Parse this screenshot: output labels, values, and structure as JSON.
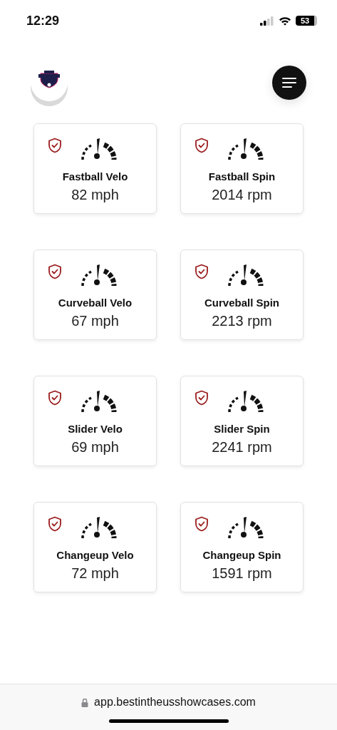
{
  "status_bar": {
    "time": "12:29",
    "battery": "53"
  },
  "metrics": [
    {
      "title": "Fastball Velo",
      "value": "82 mph"
    },
    {
      "title": "Fastball Spin",
      "value": "2014 rpm"
    },
    {
      "title": "Curveball Velo",
      "value": "67 mph"
    },
    {
      "title": "Curveball Spin",
      "value": "2213 rpm"
    },
    {
      "title": "Slider Velo",
      "value": "69 mph"
    },
    {
      "title": "Slider Spin",
      "value": "2241 rpm"
    },
    {
      "title": "Changeup Velo",
      "value": "72 mph"
    },
    {
      "title": "Changeup Spin",
      "value": "1591 rpm"
    }
  ],
  "browser_bar": {
    "url": "app.bestintheusshowcases.com"
  }
}
